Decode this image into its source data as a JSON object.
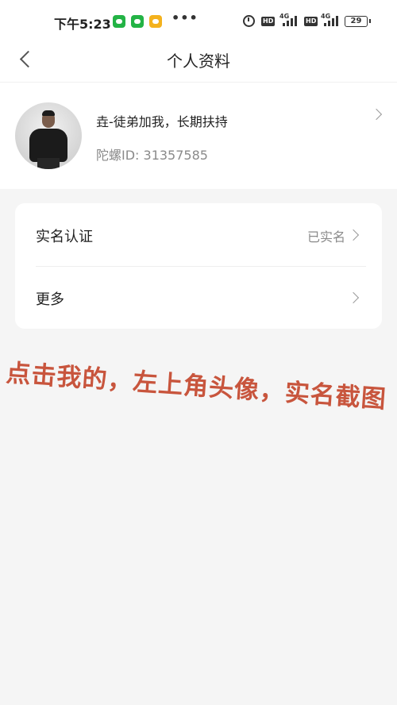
{
  "status_bar": {
    "time": "下午5:23",
    "more": "•••",
    "hd1": "HD",
    "hd2": "HD",
    "net1": "4G",
    "net2": "4G",
    "battery": "29"
  },
  "nav": {
    "title": "个人资料"
  },
  "profile": {
    "name": "垚-徒弟加我，长期扶持",
    "id_text": "陀螺ID: 31357585"
  },
  "settings": {
    "rows": [
      {
        "label": "实名认证",
        "value": "已实名"
      },
      {
        "label": "更多",
        "value": ""
      }
    ]
  },
  "annotation": {
    "text": "点击我的，左上角头像，实名截图"
  },
  "colors": {
    "background": "#f5f5f5",
    "card": "#ffffff",
    "annotation": "#c8553d",
    "wechat_icon": "#23b345",
    "notes_icon": "#f4b21d"
  },
  "icons": [
    "wechat-icon",
    "wechat-icon",
    "notes-icon",
    "alarm-icon",
    "signal-icon",
    "battery-icon",
    "back-icon",
    "chevron-right-icon"
  ]
}
